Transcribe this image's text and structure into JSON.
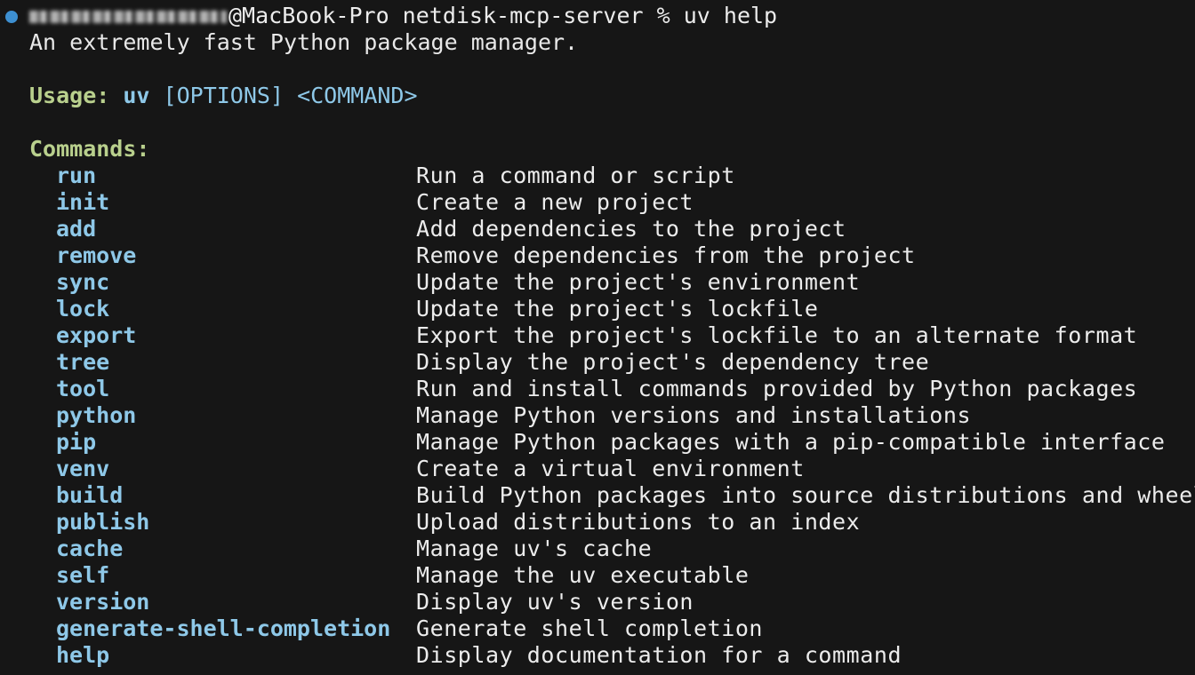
{
  "prompt": {
    "host_path": "@MacBook-Pro netdisk-mcp-server % ",
    "command": "uv help"
  },
  "description": "An extremely fast Python package manager.",
  "usage": {
    "label": "Usage:",
    "program": "uv",
    "options": "[OPTIONS]",
    "command_placeholder": "<COMMAND>"
  },
  "commands_heading": "Commands:",
  "commands": [
    {
      "name": "run",
      "description": "Run a command or script"
    },
    {
      "name": "init",
      "description": "Create a new project"
    },
    {
      "name": "add",
      "description": "Add dependencies to the project"
    },
    {
      "name": "remove",
      "description": "Remove dependencies from the project"
    },
    {
      "name": "sync",
      "description": "Update the project's environment"
    },
    {
      "name": "lock",
      "description": "Update the project's lockfile"
    },
    {
      "name": "export",
      "description": "Export the project's lockfile to an alternate format"
    },
    {
      "name": "tree",
      "description": "Display the project's dependency tree"
    },
    {
      "name": "tool",
      "description": "Run and install commands provided by Python packages"
    },
    {
      "name": "python",
      "description": "Manage Python versions and installations"
    },
    {
      "name": "pip",
      "description": "Manage Python packages with a pip-compatible interface"
    },
    {
      "name": "venv",
      "description": "Create a virtual environment"
    },
    {
      "name": "build",
      "description": "Build Python packages into source distributions and wheels"
    },
    {
      "name": "publish",
      "description": "Upload distributions to an index"
    },
    {
      "name": "cache",
      "description": "Manage uv's cache"
    },
    {
      "name": "self",
      "description": "Manage the uv executable"
    },
    {
      "name": "version",
      "description": "Display uv's version"
    },
    {
      "name": "generate-shell-completion",
      "description": "Generate shell completion"
    },
    {
      "name": "help",
      "description": "Display documentation for a command"
    }
  ],
  "colors": {
    "background": "#161616",
    "text": "#ececec",
    "heading": "#b9d08d",
    "command": "#8ec8e8",
    "status_dot": "#3d8fd1"
  }
}
